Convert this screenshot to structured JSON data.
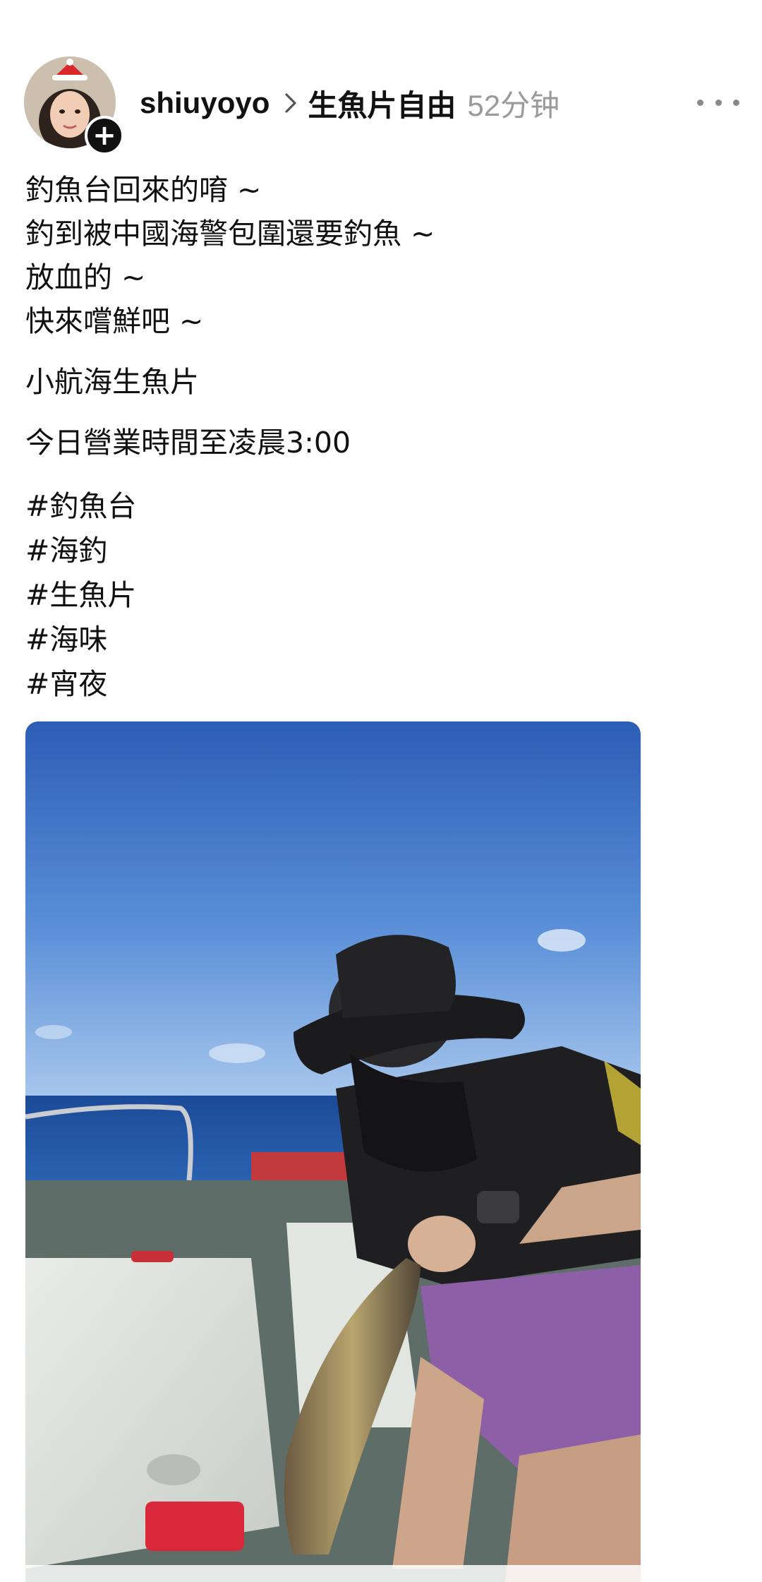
{
  "header": {
    "username": "shiuyoyo",
    "topic": "生魚片自由",
    "time": "52分钟"
  },
  "post": {
    "lines": [
      "釣魚台回來的唷 ~",
      "釣到被中國海警包圍還要釣魚 ~",
      "放血的 ~",
      "快來嚐鮮吧 ~"
    ],
    "shop_name": "小航海生魚片",
    "hours": "今日營業時間至凌晨3:00",
    "hashtags": [
      "#釣魚台",
      "#海釣",
      "#生魚片",
      "#海味",
      "#宵夜"
    ]
  },
  "icons": {
    "avatar": "avatar-photo",
    "follow": "plus-icon",
    "chevron": "chevron-right-icon",
    "more": "more-horizontal-icon"
  },
  "media": {
    "description_icon": "photo-image"
  },
  "colors": {
    "text": "#111111",
    "muted": "#9a9a9a",
    "sky_top": "#2f63b9",
    "sky_bottom": "#8bb4e6",
    "sea": "#1c4a92",
    "shorts": "#8c5fa6"
  }
}
